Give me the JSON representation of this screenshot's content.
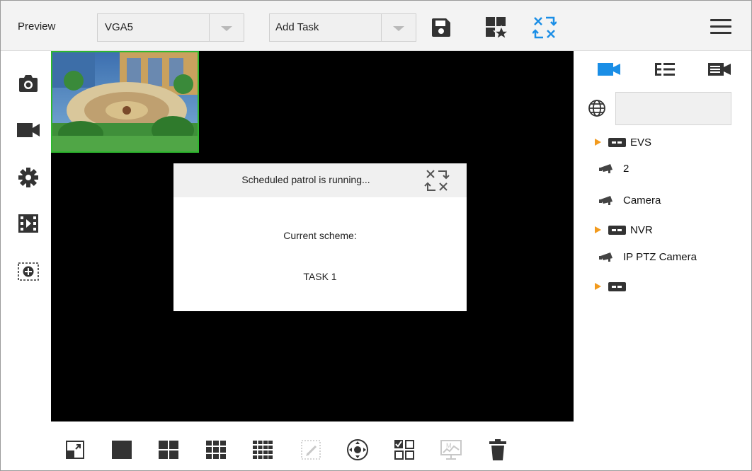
{
  "app": {
    "title": "Preview"
  },
  "toolbar": {
    "view_select": {
      "value": "VGA5"
    },
    "task_select": {
      "value": "Add Task"
    },
    "save_icon": "save-icon",
    "favorite_icon": "favorite-view-icon",
    "patrol_icon": "patrol-icon",
    "menu_icon": "menu-icon"
  },
  "left_tools": [
    "camera-snapshot-icon",
    "video-record-icon",
    "settings-gear-icon",
    "playback-film-icon",
    "add-window-icon"
  ],
  "dialog": {
    "title": "Scheduled patrol is running...",
    "scheme_label": "Current scheme:",
    "scheme_value": "TASK 1"
  },
  "right_panel": {
    "tabs": [
      "camera-list-icon",
      "group-list-icon",
      "view-list-icon"
    ],
    "tree": [
      {
        "type": "device",
        "label": "EVS",
        "expandable": true
      },
      {
        "type": "camera",
        "label": "2",
        "expandable": false
      },
      {
        "type": "camera",
        "label": "Camera",
        "expandable": false
      },
      {
        "type": "device",
        "label": "NVR",
        "expandable": true
      },
      {
        "type": "camera",
        "label": "IP PTZ Camera",
        "expandable": false
      },
      {
        "type": "device",
        "label": "",
        "expandable": true
      }
    ]
  },
  "bottom_toolbar": [
    "fullscreen-icon",
    "layout-1-icon",
    "layout-4-icon",
    "layout-9-icon",
    "layout-16-icon",
    "custom-layout-icon",
    "ptz-control-icon",
    "multi-select-icon",
    "monitor-icon",
    "delete-icon"
  ],
  "colors": {
    "accent": "#1a8ee6",
    "thumbnail_border": "#2eb82e",
    "tree_arrow": "#f29a1d",
    "video_background": "#000000"
  }
}
